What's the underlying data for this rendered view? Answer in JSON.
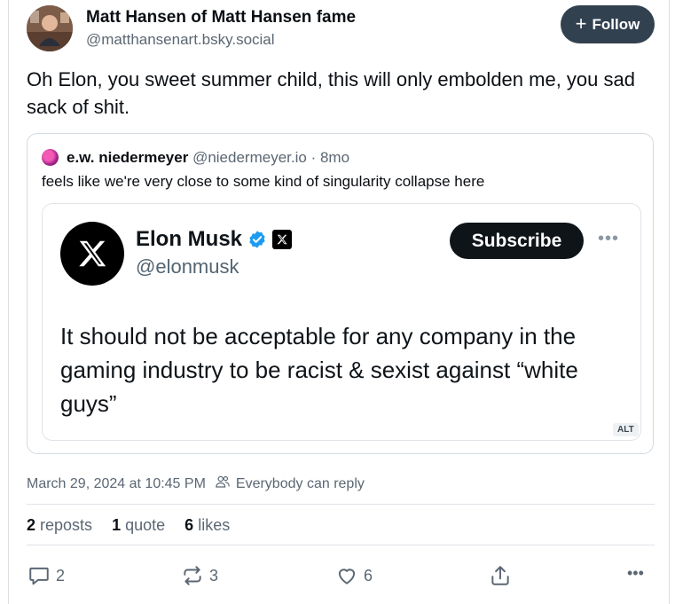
{
  "post": {
    "author_name": "Matt Hansen of Matt Hansen fame",
    "author_handle": "@matthansenart.bsky.social",
    "follow_label": "Follow",
    "follow_icon": "+",
    "text": "Oh Elon, you sweet summer child, this will only embolden me, you sad sack of shit."
  },
  "quote": {
    "author_name": "e.w. niedermeyer",
    "author_handle": "@niedermeyer.io",
    "separator": "·",
    "age": "8mo",
    "text": "feels like we're very close to some kind of singularity collapse here",
    "embed": {
      "name": "Elon Musk",
      "handle": "@elonmusk",
      "subscribe_label": "Subscribe",
      "more_label": "•••",
      "text": "It should not be acceptable for any company in the gaming industry to be racist & sexist against “white guys”",
      "alt_label": "ALT",
      "verified_color": "#1d9bf0"
    }
  },
  "meta": {
    "timestamp": "March 29, 2024 at 10:45 PM",
    "reply_setting": "Everybody can reply"
  },
  "stats": {
    "reposts_count": "2",
    "reposts_label": "reposts",
    "quotes_count": "1",
    "quotes_label": "quote",
    "likes_count": "6",
    "likes_label": "likes"
  },
  "actions": {
    "reply_count": "2",
    "repost_count": "3",
    "like_count": "6",
    "more_label": "•••"
  },
  "colors": {
    "follow_bg": "#324150",
    "muted_text": "#5b6773",
    "border": "#d4dbe2"
  }
}
